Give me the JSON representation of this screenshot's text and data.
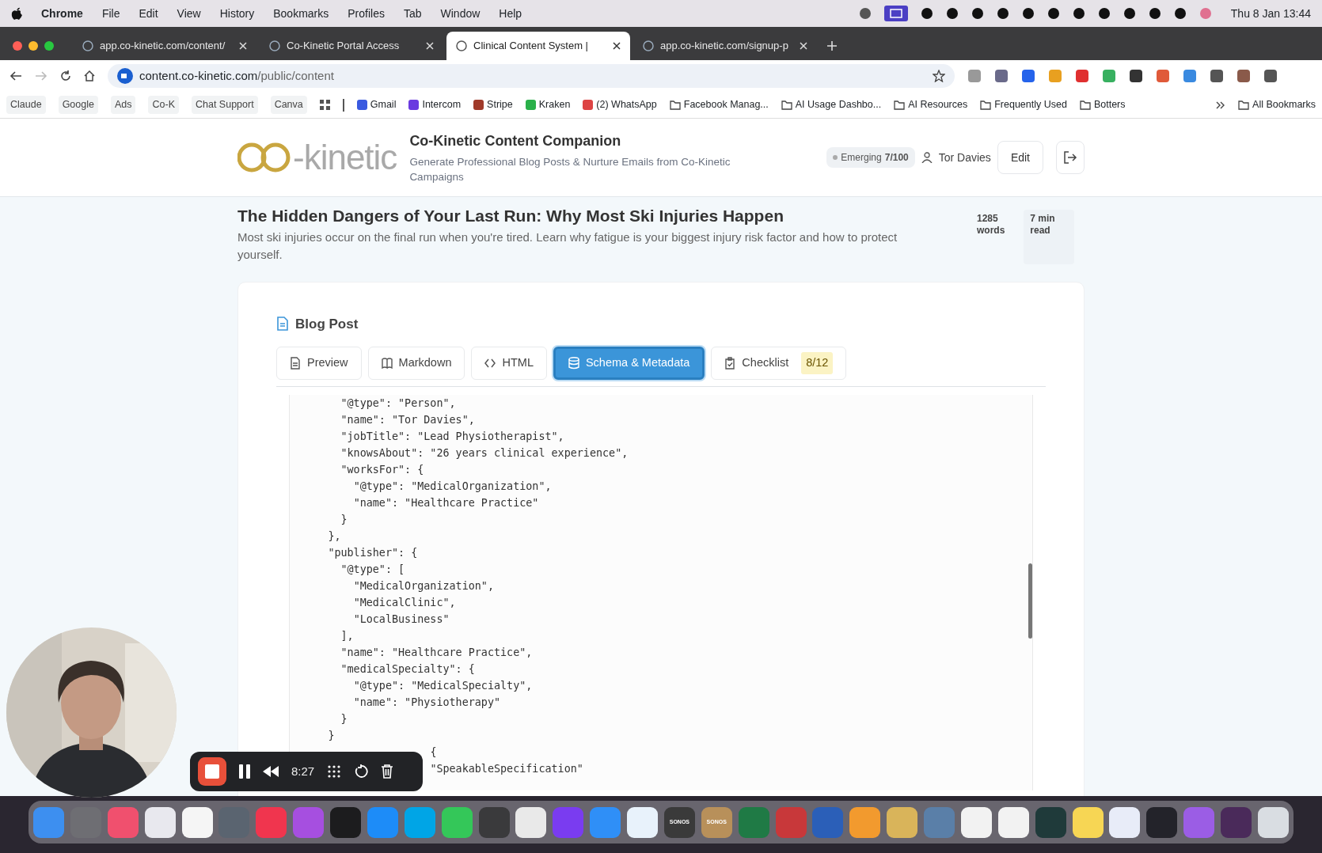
{
  "menu_bar": {
    "items": [
      "Chrome",
      "File",
      "Edit",
      "View",
      "History",
      "Bookmarks",
      "Profiles",
      "Tab",
      "Window",
      "Help"
    ],
    "clock": "Thu 8 Jan  13:44"
  },
  "browser_tabs": [
    {
      "title": "app.co-kinetic.com/content/",
      "selected": false
    },
    {
      "title": "Co-Kinetic Portal Access",
      "selected": false
    },
    {
      "title": "Clinical Content System |",
      "selected": true
    },
    {
      "title": "app.co-kinetic.com/signup-p",
      "selected": false
    }
  ],
  "address_bar": {
    "host": "content.co-kinetic.com",
    "path": "/public/content"
  },
  "bookmarks": [
    {
      "label": "Claude",
      "kind": "chip"
    },
    {
      "label": "Google",
      "kind": "chip"
    },
    {
      "label": "Ads",
      "kind": "chip"
    },
    {
      "label": "Co-K",
      "kind": "chip"
    },
    {
      "label": "Chat Support",
      "kind": "chip"
    },
    {
      "label": "Canva",
      "kind": "chip"
    },
    {
      "label": "Gmail",
      "kind": "site"
    },
    {
      "label": "Intercom",
      "kind": "site"
    },
    {
      "label": "Stripe",
      "kind": "site"
    },
    {
      "label": "Kraken",
      "kind": "site"
    },
    {
      "label": "(2) WhatsApp",
      "kind": "site"
    },
    {
      "label": "Facebook Manag...",
      "kind": "folder"
    },
    {
      "label": "AI Usage Dashbo...",
      "kind": "folder"
    },
    {
      "label": "AI Resources",
      "kind": "folder"
    },
    {
      "label": "Frequently Used",
      "kind": "folder"
    },
    {
      "label": "Botters",
      "kind": "folder"
    }
  ],
  "all_bookmarks": "All Bookmarks",
  "app_header": {
    "logo_text": "-kinetic",
    "title": "Co-Kinetic Content Companion",
    "subtitle": "Generate Professional Blog Posts & Nurture Emails from Co-Kinetic Campaigns",
    "level_label": "Emerging",
    "level_score": "7/100",
    "user": "Tor Davies",
    "edit_button": "Edit"
  },
  "article": {
    "title": "The Hidden Dangers of Your Last Run: Why Most Ski Injuries Happen",
    "summary": "Most ski injuries occur on the final run when you're tired. Learn why fatigue is your biggest injury risk factor and how to protect yourself.",
    "word_count": "1285",
    "word_unit": "words",
    "read_time": "7 min",
    "read_unit": "read"
  },
  "card": {
    "title": "Blog Post",
    "tabs": [
      {
        "label": "Preview",
        "selected": false
      },
      {
        "label": "Markdown",
        "selected": false
      },
      {
        "label": "HTML",
        "selected": false
      },
      {
        "label": "Schema & Metadata",
        "selected": true
      },
      {
        "label": "Checklist",
        "selected": false,
        "badge": "8/12"
      }
    ],
    "code_lines": [
      "        \"@type\": \"Person\",",
      "        \"name\": \"Tor Davies\",",
      "        \"jobTitle\": \"Lead Physiotherapist\",",
      "        \"knowsAbout\": \"26 years clinical experience\",",
      "        \"worksFor\": {",
      "          \"@type\": \"MedicalOrganization\",",
      "          \"name\": \"Healthcare Practice\"",
      "        }",
      "      },",
      "      \"publisher\": {",
      "        \"@type\": [",
      "          \"MedicalOrganization\",",
      "          \"MedicalClinic\",",
      "          \"LocalBusiness\"",
      "        ],",
      "        \"name\": \"Healthcare Practice\",",
      "        \"medicalSpecialty\": {",
      "          \"@type\": \"MedicalSpecialty\",",
      "          \"name\": \"Physiotherapy\"",
      "        }",
      "      }",
      "                      {",
      "                      \"SpeakableSpecification\""
    ]
  },
  "recorder": {
    "time": "8:27"
  },
  "dock": [
    {
      "color": "#3d8ff0"
    },
    {
      "color": "#6e6e73"
    },
    {
      "color": "#f0506e"
    },
    {
      "color": "#e8e8ee"
    },
    {
      "color": "#f5f5f5"
    },
    {
      "color": "#5a6470"
    },
    {
      "color": "#f0354e"
    },
    {
      "color": "#a64fe0"
    },
    {
      "color": "#1c1c1e"
    },
    {
      "color": "#1d8cf8"
    },
    {
      "color": "#00a5e6"
    },
    {
      "color": "#34c759"
    },
    {
      "color": "#3a3a3c"
    },
    {
      "color": "#e9e9e9"
    },
    {
      "color": "#7a3cf0"
    },
    {
      "color": "#2f8ff7"
    },
    {
      "color": "#e8f2fb"
    },
    {
      "color": "#3a3a3a",
      "label": "SONOS"
    },
    {
      "color": "#b8905a",
      "label": "SONOS"
    },
    {
      "color": "#1f7a45"
    },
    {
      "color": "#c8383a"
    },
    {
      "color": "#2b5fb8"
    },
    {
      "color": "#f29a2e"
    },
    {
      "color": "#d9b45a"
    },
    {
      "color": "#5a7fa8"
    },
    {
      "color": "#f2f2f2"
    },
    {
      "color": "#f2f2f2"
    },
    {
      "color": "#1f3a3a"
    },
    {
      "color": "#f7d654"
    },
    {
      "color": "#e8ecf8"
    },
    {
      "color": "#23232a"
    },
    {
      "color": "#9b5de5"
    },
    {
      "color": "#4a2a5a"
    },
    {
      "color": "#d9dde2"
    }
  ]
}
